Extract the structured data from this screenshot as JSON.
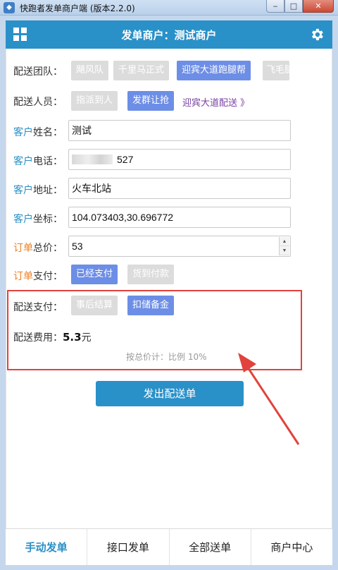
{
  "window": {
    "title": "快跑者发单商户端 (版本2.2.0)",
    "app_icon": "app-logo-icon",
    "minimize": "‒",
    "maximize": "□",
    "close": "✕"
  },
  "header": {
    "title": "发单商户：测试商户",
    "left_icon": "grid-menu-icon",
    "right_icon": "gear-icon",
    "color": "#2a90c8"
  },
  "form": {
    "team": {
      "label": "配送团队：",
      "options": [
        {
          "label": "飓风队",
          "selected": false
        },
        {
          "label": "千里马正式",
          "selected": false
        },
        {
          "label": "迎宾大道跑腿帮",
          "selected": true
        },
        {
          "label": "飞毛腿",
          "selected": false
        }
      ]
    },
    "courier": {
      "label": "配送人员：",
      "options": [
        {
          "label": "指派到人",
          "selected": false
        },
        {
          "label": "发群让抢",
          "selected": true
        }
      ],
      "link": "迎宾大道配送 》"
    },
    "name": {
      "label_a": "客户",
      "label_b": "姓名：",
      "value": "测试"
    },
    "phone": {
      "label_a": "客户",
      "label_b": "电话：",
      "value": "527"
    },
    "address": {
      "label_a": "客户",
      "label_b": "地址：",
      "value": "火车北站"
    },
    "coords": {
      "label_a": "客户",
      "label_b": "坐标：",
      "value": "104.073403,30.696772"
    },
    "total": {
      "label_a": "订单",
      "label_b": "总价：",
      "value": "53"
    },
    "order_pay": {
      "label_a": "订单",
      "label_b": "支付：",
      "options": [
        {
          "label": "已经支付",
          "selected": true
        },
        {
          "label": "货到付款",
          "selected": false
        }
      ]
    },
    "delivery_pay": {
      "label": "配送支付：",
      "options": [
        {
          "label": "事后结算",
          "selected": false
        },
        {
          "label": "扣储备金",
          "selected": true
        }
      ]
    },
    "fee": {
      "label": "配送费用：",
      "amount": "5.3",
      "unit": "元"
    },
    "fee_note": "按总价计：比例 10%",
    "submit": "发出配送单"
  },
  "tabs": [
    {
      "label": "手动发单",
      "active": true
    },
    {
      "label": "接口发单",
      "active": false
    },
    {
      "label": "全部送单",
      "active": false
    },
    {
      "label": "商户中心",
      "active": false
    }
  ],
  "colors": {
    "accent": "#2a90c8",
    "chip_selected": "#6d8ee6",
    "chip_unselected": "#dcdcdc",
    "highlight": "#e1423c",
    "label_blue": "#2a8fc7",
    "label_orange": "#ee7f23"
  }
}
